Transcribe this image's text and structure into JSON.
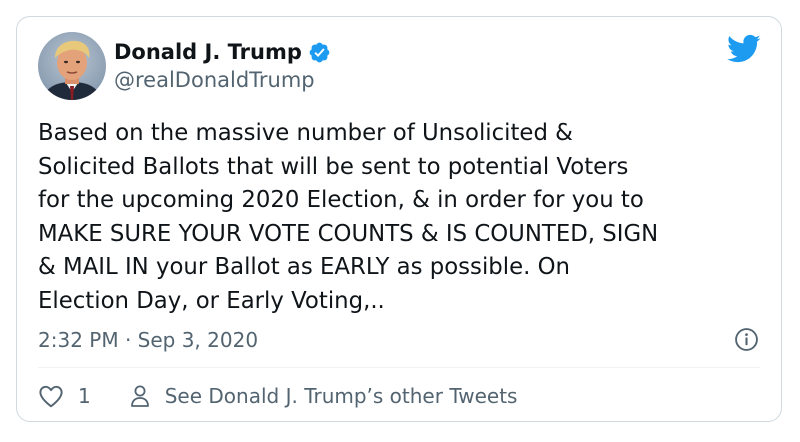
{
  "tweet": {
    "author": {
      "display_name": "Donald J. Trump",
      "handle": "@realDonaldTrump",
      "verified": true
    },
    "text": "Based on the massive number of Unsolicited &\nSolicited Ballots that will be sent to potential Voters\nfor the upcoming 2020 Election, & in order for you to\nMAKE SURE YOUR VOTE COUNTS & IS COUNTED, SIGN\n& MAIL IN your Ballot as EARLY as possible. On\nElection Day, or Early Voting,..",
    "timestamp": "2:32 PM · Sep 3, 2020",
    "like_count": "1",
    "see_others_label": "See Donald J. Trump’s other Tweets"
  },
  "icons": {
    "brand": "twitter-bird-icon",
    "verified": "verified-badge-icon",
    "info": "info-icon",
    "like": "heart-icon",
    "profile": "person-icon"
  },
  "colors": {
    "brand_blue": "#1d9bf0",
    "text_primary": "#0f1419",
    "text_secondary": "#536471",
    "border": "#cfd9de"
  }
}
